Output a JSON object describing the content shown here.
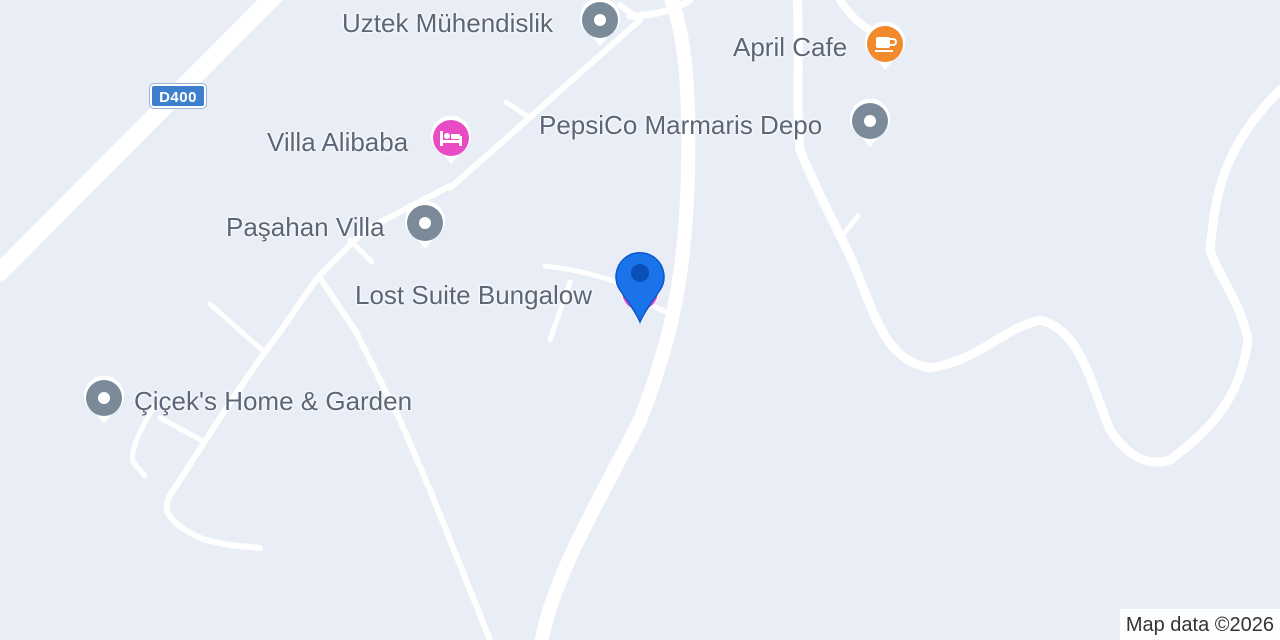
{
  "map": {
    "road_shield": "D400",
    "attribution": "Map data ©2026",
    "places": [
      {
        "name": "Uztek Mühendislik",
        "category": "generic",
        "icon": "pin-generic-icon",
        "color": "#7b8a99"
      },
      {
        "name": "April Cafe",
        "category": "cafe",
        "icon": "coffee-cup-icon",
        "color": "#f08a2c"
      },
      {
        "name": "PepsiCo Marmaris Depo",
        "category": "generic",
        "icon": "pin-generic-icon",
        "color": "#7b8a99"
      },
      {
        "name": "Villa Alibaba",
        "category": "lodging",
        "icon": "bed-icon",
        "color": "#e94bc4"
      },
      {
        "name": "Paşahan Villa",
        "category": "generic",
        "icon": "pin-generic-icon",
        "color": "#7b8a99"
      },
      {
        "name": "Lost Suite Bungalow",
        "category": "lodging",
        "icon": "bed-icon",
        "color": "#e94bc4"
      },
      {
        "name": "Çiçek's Home & Garden",
        "category": "generic",
        "icon": "pin-generic-icon",
        "color": "#7b8a99"
      }
    ],
    "selected_marker": {
      "icon": "location-marker-icon",
      "color": "#1a73e8"
    }
  }
}
